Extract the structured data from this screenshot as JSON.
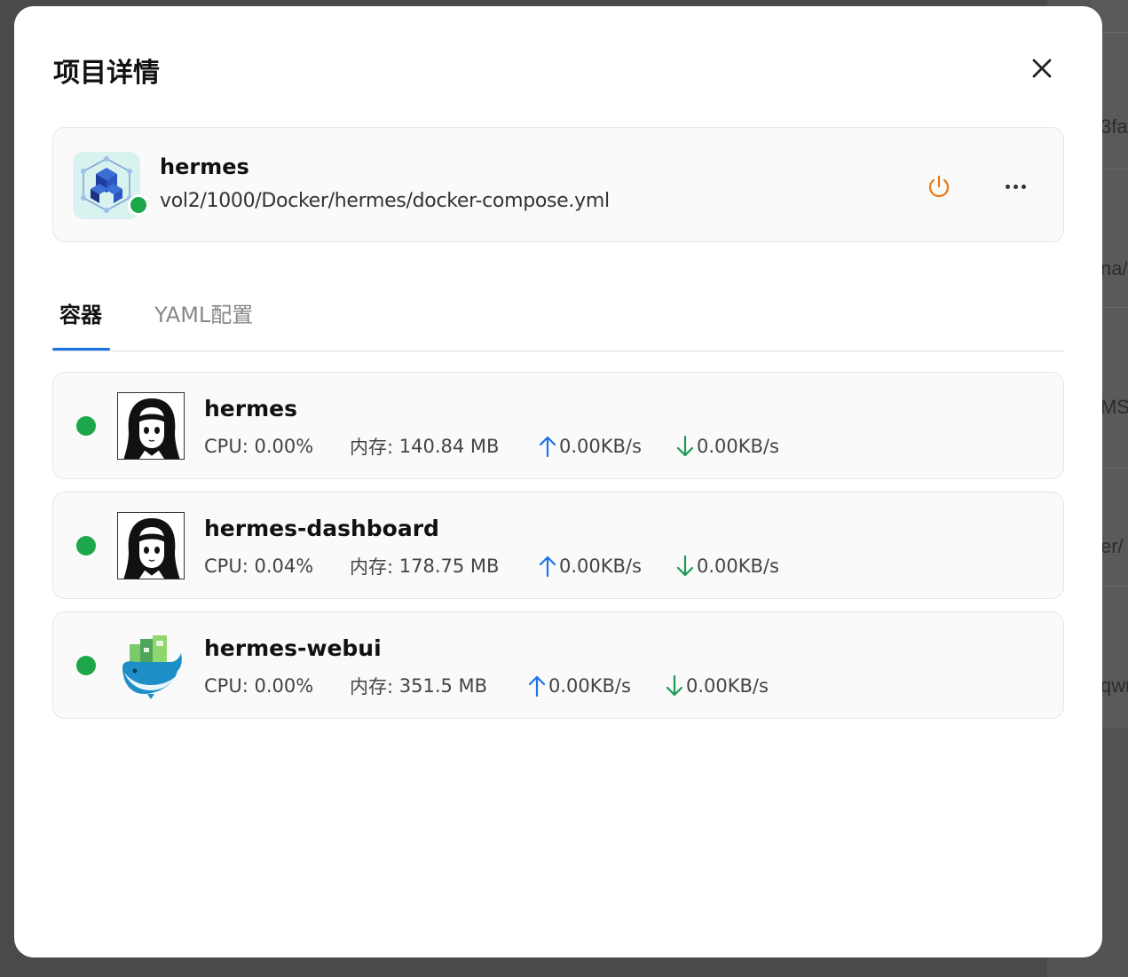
{
  "modal": {
    "title": "项目详情"
  },
  "background_fragments": [
    "3fa",
    "na/",
    "MSI",
    "er/",
    "qwr"
  ],
  "project": {
    "name": "hermes",
    "path": "vol2/1000/Docker/hermes/docker-compose.yml",
    "status": "running",
    "status_color": "#1da64a",
    "power_color": "#e8790f"
  },
  "tabs": [
    {
      "label": "容器",
      "active": true
    },
    {
      "label": "YAML配置",
      "active": false
    }
  ],
  "containers": [
    {
      "name": "hermes",
      "cpu_label": "CPU:",
      "cpu": "0.00%",
      "mem_label": "内存:",
      "mem": "140.84 MB",
      "upload": "0.00KB/s",
      "download": "0.00KB/s",
      "icon": "anime-girl-avatar"
    },
    {
      "name": "hermes-dashboard",
      "cpu_label": "CPU:",
      "cpu": "0.04%",
      "mem_label": "内存:",
      "mem": "178.75 MB",
      "upload": "0.00KB/s",
      "download": "0.00KB/s",
      "icon": "anime-girl-avatar"
    },
    {
      "name": "hermes-webui",
      "cpu_label": "CPU:",
      "cpu": "0.00%",
      "mem_label": "内存:",
      "mem": "351.5 MB",
      "upload": "0.00KB/s",
      "download": "0.00KB/s",
      "icon": "whale-icon"
    }
  ],
  "colors": {
    "upload_arrow": "#1a73e8",
    "download_arrow": "#1a9a55",
    "tab_accent": "#1a73e8"
  }
}
